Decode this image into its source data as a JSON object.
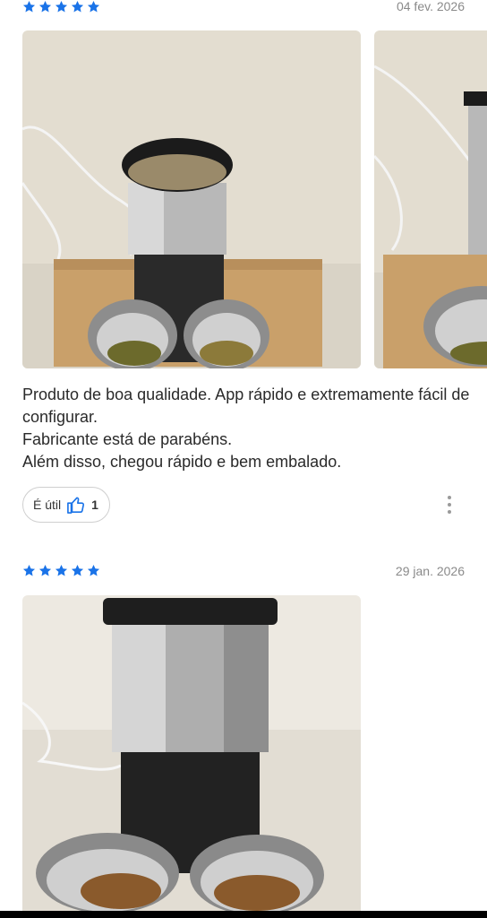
{
  "reviews": [
    {
      "rating": 5,
      "date": "04 fev. 2026",
      "text_lines": [
        "Produto de boa qualidade. App rápido e extremamente fácil de configurar.",
        "Fabricante está de parabéns.",
        "Além disso, chegou rápido e bem embalado."
      ],
      "helpful_label": "É útil",
      "helpful_count": "1",
      "photos": [
        "photo-feeder-bowls",
        "photo-feeder-side"
      ]
    },
    {
      "rating": 5,
      "date": "29 jan. 2026",
      "photos": [
        "photo-feeder-front"
      ]
    }
  ],
  "colors": {
    "star": "#1a73e8",
    "accent": "#1a73e8",
    "date_text": "#8a8a8a"
  },
  "icons": {
    "star": "star-icon",
    "thumbs_up": "thumbs-up-icon",
    "more": "more-vertical-icon"
  }
}
